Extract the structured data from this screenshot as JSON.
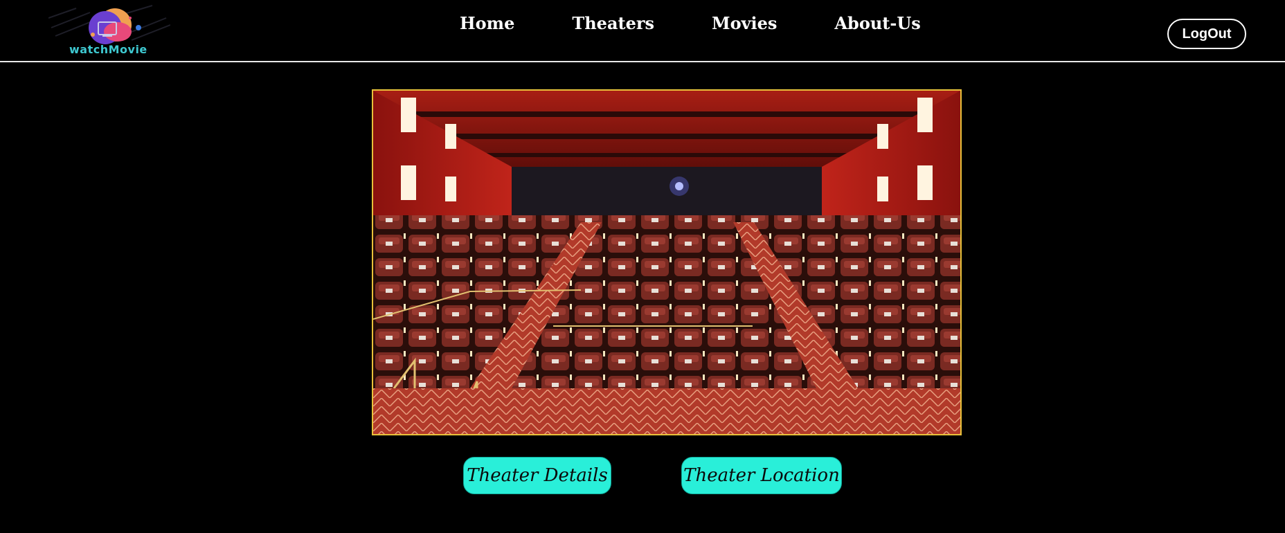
{
  "brand": {
    "logo_text": "watchMovie"
  },
  "nav": {
    "items": [
      {
        "label": "Home"
      },
      {
        "label": "Theaters"
      },
      {
        "label": "Movies"
      },
      {
        "label": "About-Us"
      }
    ],
    "logout_label": "LogOut"
  },
  "hero": {
    "image_subject": "cinema-auditorium-photo"
  },
  "actions": {
    "details_label": "Theater Details",
    "location_label": "Theater Location"
  },
  "colors": {
    "background": "#000000",
    "accent_button": "#29efd9",
    "image_border": "#e8c13a",
    "logo_text": "#3ec8d0"
  }
}
